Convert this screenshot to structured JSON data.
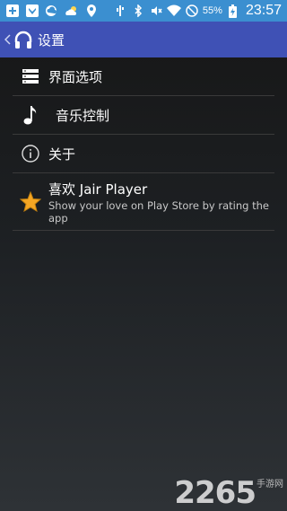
{
  "status_bar": {
    "battery_percent": "55%",
    "time": "23:57",
    "icons_left": [
      "add-icon",
      "bird-icon",
      "cloud-icon",
      "weather-icon",
      "location-icon"
    ],
    "icons_right": [
      "usb-icon",
      "bluetooth-icon",
      "mute-icon",
      "wifi-icon",
      "no-disturb-icon",
      "battery-icon"
    ]
  },
  "action_bar": {
    "title": "设置",
    "icon": "headphones-icon"
  },
  "settings": {
    "items": [
      {
        "label": "界面选项",
        "icon": "list-icon"
      },
      {
        "label": "音乐控制",
        "icon": "music-note-icon"
      },
      {
        "label": "关于",
        "icon": "info-icon"
      },
      {
        "label": "喜欢 Jair Player",
        "summary": "Show your love on Play Store by rating the app",
        "icon": "star-icon"
      }
    ]
  },
  "colors": {
    "status_bar": "#3b8fd0",
    "action_bar": "#3f51b5",
    "star": "#f5a623"
  }
}
